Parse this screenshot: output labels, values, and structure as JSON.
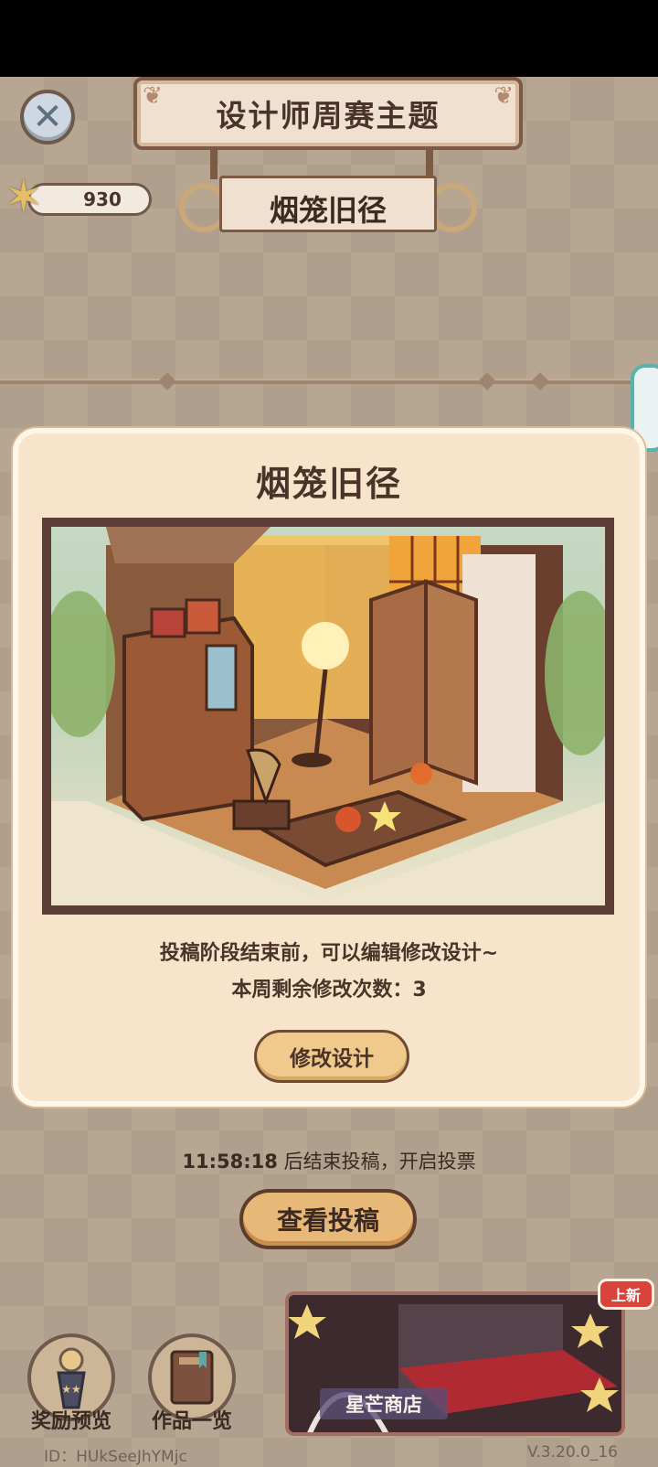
{
  "header": {
    "title": "设计师周赛主题",
    "theme_name": "烟笼旧径",
    "star_count": "930"
  },
  "modal": {
    "title": "烟笼旧径",
    "info_line_1": "投稿阶段结束前，可以编辑修改设计~",
    "info_line_2": "本周剩余修改次数：3",
    "modify_button": "修改设计"
  },
  "submission": {
    "countdown_time": "11:58:18",
    "countdown_suffix": "后结束投稿，开启投票",
    "view_button": "查看投稿"
  },
  "bottom_nav": {
    "reward_label": "奖励预览",
    "works_label": "作品一览",
    "shop_label": "星芒商店",
    "new_badge": "上新"
  },
  "footer": {
    "id_text": "ID：HUkSeeJhYMjc",
    "version": "V.3.20.0_16"
  },
  "colors": {
    "accent_orange": "#e8b878",
    "modal_bg": "#f8e4ca",
    "text_dark": "#4a3328",
    "badge_red": "#d9443a"
  }
}
